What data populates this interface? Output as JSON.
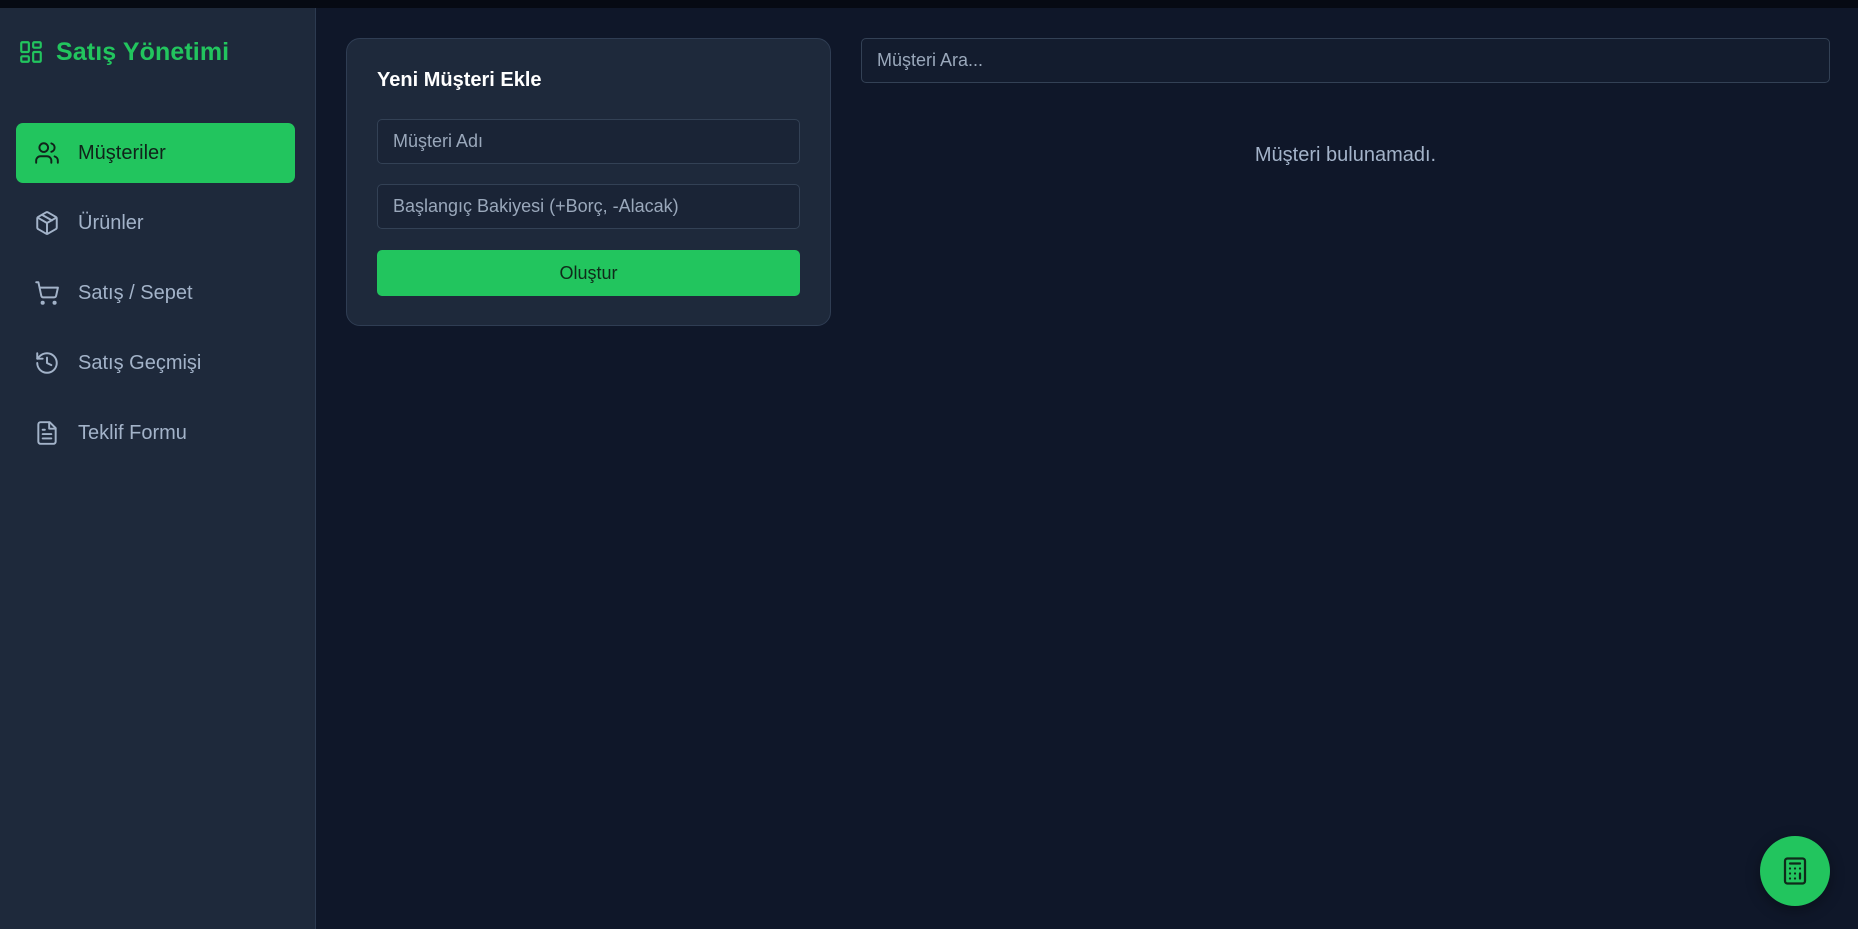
{
  "app": {
    "title": "Satış Yönetimi",
    "accent_color": "#22c55e"
  },
  "sidebar": {
    "items": [
      {
        "label": "Müşteriler",
        "icon": "users-icon",
        "active": true
      },
      {
        "label": "Ürünler",
        "icon": "package-icon",
        "active": false
      },
      {
        "label": "Satış / Sepet",
        "icon": "cart-icon",
        "active": false
      },
      {
        "label": "Satış Geçmişi",
        "icon": "history-icon",
        "active": false
      },
      {
        "label": "Teklif Formu",
        "icon": "document-icon",
        "active": false
      }
    ]
  },
  "new_customer_form": {
    "title": "Yeni Müşteri Ekle",
    "name_placeholder": "Müşteri Adı",
    "name_value": "",
    "balance_placeholder": "Başlangıç Bakiyesi (+Borç, -Alacak)",
    "balance_value": "",
    "submit_label": "Oluştur"
  },
  "customer_list": {
    "search_placeholder": "Müşteri Ara...",
    "search_value": "",
    "empty_message": "Müşteri bulunamadı."
  },
  "fab": {
    "icon": "calculator-icon"
  }
}
